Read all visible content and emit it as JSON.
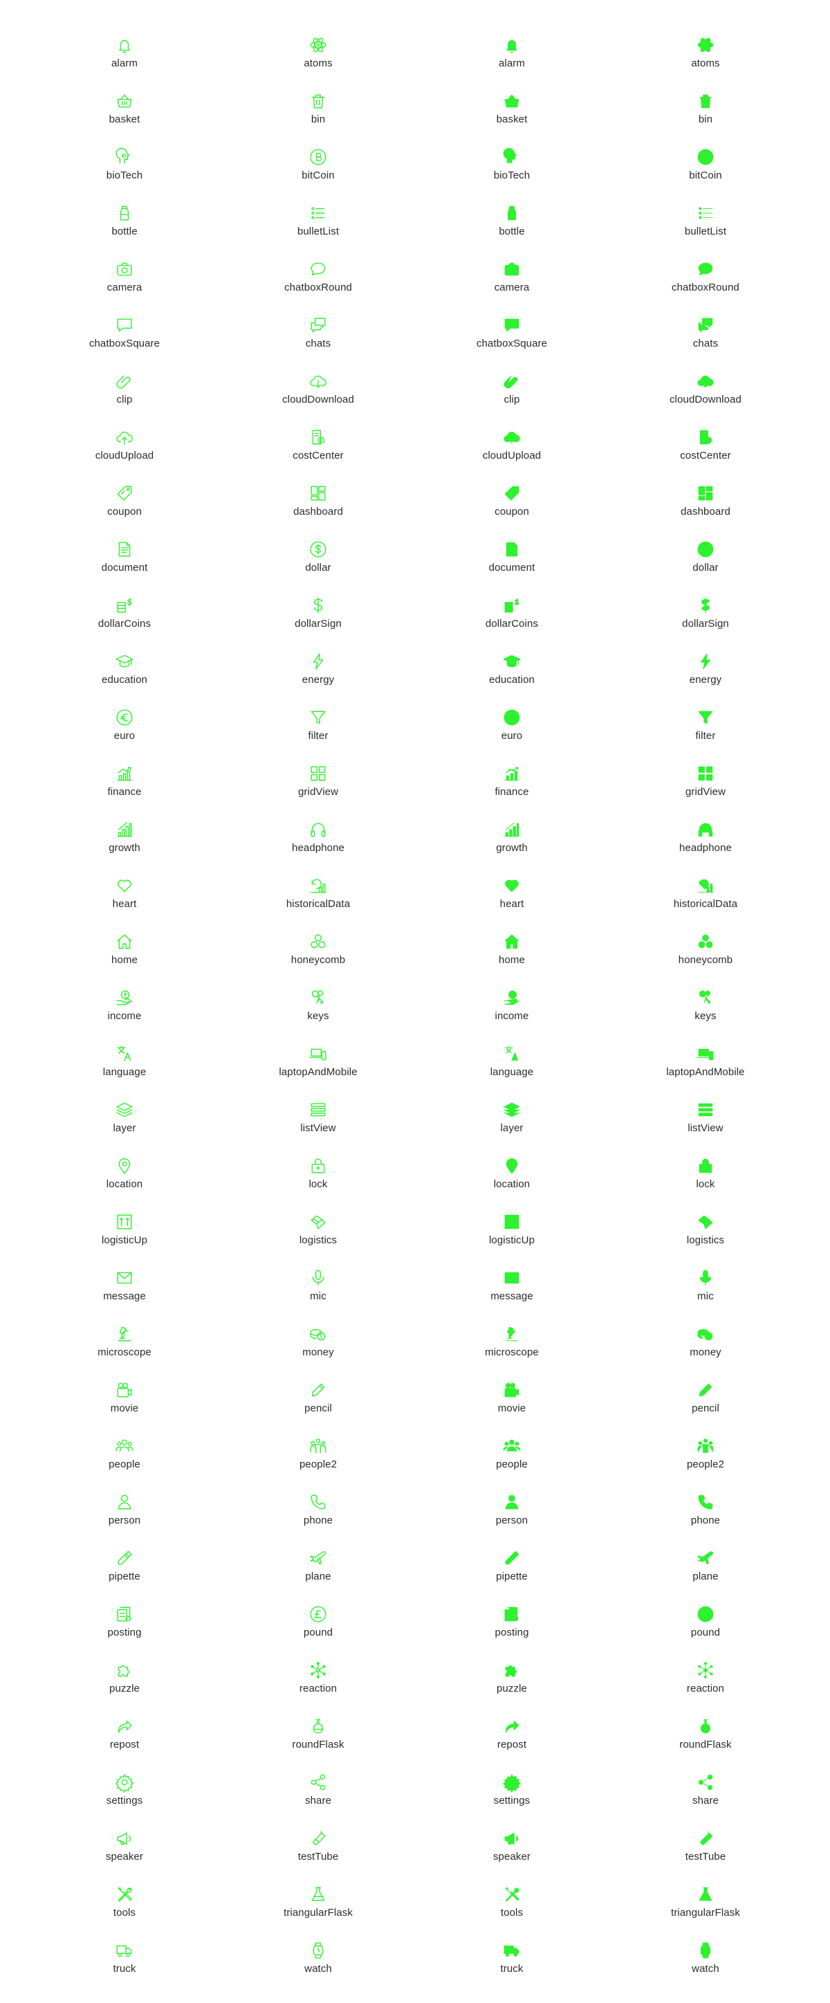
{
  "icon_color": "#2ff12f",
  "label_color": "#2b2b2b",
  "background": "#ffffff",
  "rows": [
    [
      "alarm",
      "atoms"
    ],
    [
      "basket",
      "bin"
    ],
    [
      "bioTech",
      "bitCoin"
    ],
    [
      "bottle",
      "bulletList"
    ],
    [
      "camera",
      "chatboxRound"
    ],
    [
      "chatboxSquare",
      "chats"
    ],
    [
      "clip",
      "cloudDownload"
    ],
    [
      "cloudUpload",
      "costCenter"
    ],
    [
      "coupon",
      "dashboard"
    ],
    [
      "document",
      "dollar"
    ],
    [
      "dollarCoins",
      "dollarSign"
    ],
    [
      "education",
      "energy"
    ],
    [
      "euro",
      "filter"
    ],
    [
      "finance",
      "gridView"
    ],
    [
      "growth",
      "headphone"
    ],
    [
      "heart",
      "historicalData"
    ],
    [
      "home",
      "honeycomb"
    ],
    [
      "income",
      "keys"
    ],
    [
      "language",
      "laptopAndMobile"
    ],
    [
      "layer",
      "listView"
    ],
    [
      "location",
      "lock"
    ],
    [
      "logisticUp",
      "logistics"
    ],
    [
      "message",
      "mic"
    ],
    [
      "microscope",
      "money"
    ],
    [
      "movie",
      "pencil"
    ],
    [
      "people",
      "people2"
    ],
    [
      "person",
      "phone"
    ],
    [
      "pipette",
      "plane"
    ],
    [
      "posting",
      "pound"
    ],
    [
      "puzzle",
      "reaction"
    ],
    [
      "repost",
      "roundFlask"
    ],
    [
      "settings",
      "share"
    ],
    [
      "speaker",
      "testTube"
    ],
    [
      "tools",
      "triangularFlask"
    ],
    [
      "truck",
      "watch"
    ]
  ],
  "sets": [
    "outline",
    "filled"
  ]
}
